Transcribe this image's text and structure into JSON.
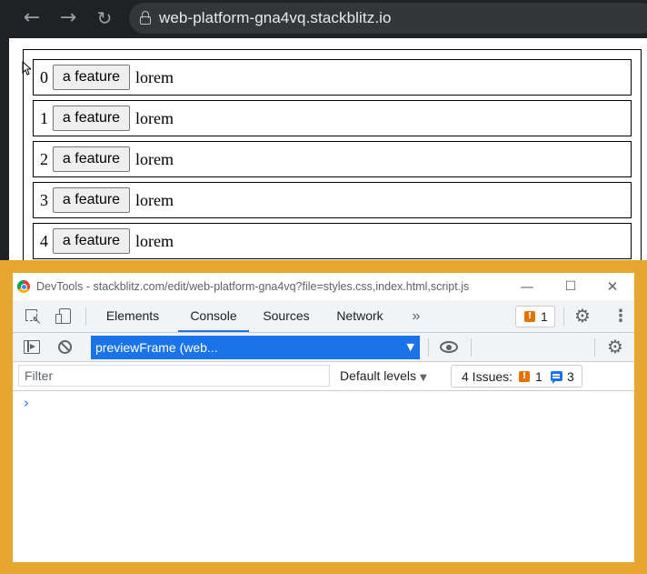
{
  "browser": {
    "back_icon": "←",
    "forward_icon": "→",
    "reload_icon": "↻",
    "url": "web-platform-gna4vq.stackblitz.io"
  },
  "page": {
    "rows": [
      {
        "index": "0",
        "button_label": "a feature",
        "text": "lorem"
      },
      {
        "index": "1",
        "button_label": "a feature",
        "text": "lorem"
      },
      {
        "index": "2",
        "button_label": "a feature",
        "text": "lorem"
      },
      {
        "index": "3",
        "button_label": "a feature",
        "text": "lorem"
      },
      {
        "index": "4",
        "button_label": "a feature",
        "text": "lorem"
      }
    ]
  },
  "devtools": {
    "window_title": "DevTools - stackblitz.com/edit/web-platform-gna4vq?file=styles.css,index.html,script.js",
    "window_controls": {
      "minimize": "—",
      "maximize": "☐",
      "close": "✕"
    },
    "tabs": [
      {
        "label": "Elements",
        "active": false
      },
      {
        "label": "Console",
        "active": true
      },
      {
        "label": "Sources",
        "active": false
      },
      {
        "label": "Network",
        "active": false
      }
    ],
    "more_tabs": "»",
    "issues_badge": {
      "count": "1"
    },
    "settings_icon": "⚙",
    "menu_icon": "⋮",
    "context_select": {
      "value": "previewFrame (web...",
      "arrow": "▼"
    },
    "filter": {
      "placeholder": "Filter",
      "value": ""
    },
    "levels": {
      "label": "Default levels",
      "arrow": "▼"
    },
    "issues_summary": {
      "label": "4 Issues:",
      "warnings": "1",
      "info": "3"
    },
    "prompt": "›"
  },
  "colors": {
    "devtools_frame": "#e6a630",
    "accent": "#1a73e8",
    "warning": "#e37400"
  }
}
